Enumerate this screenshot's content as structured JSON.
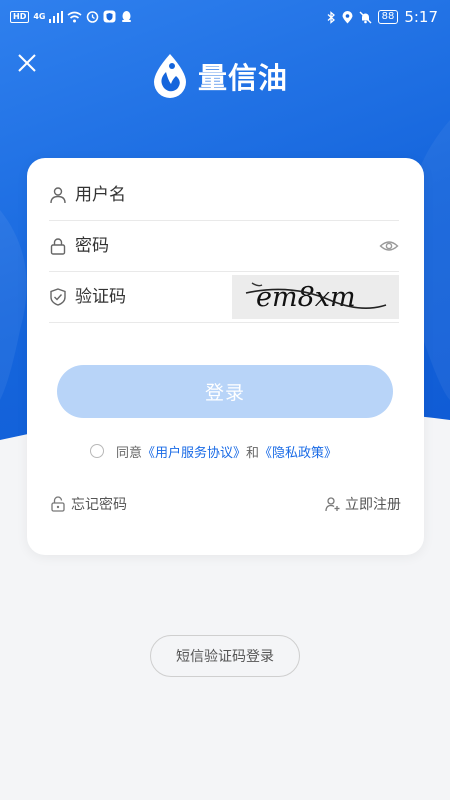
{
  "status_bar": {
    "hd": "HD",
    "network": "4G",
    "battery": "88",
    "time": "5:17"
  },
  "app": {
    "name": "量信油"
  },
  "form": {
    "username_placeholder": "用户名",
    "password_placeholder": "密码",
    "captcha_placeholder": "验证码",
    "captcha_text": "em8xm"
  },
  "login_button": "登录",
  "agreement": {
    "prefix": "同意",
    "terms": "《用户服务协议》",
    "and": "和",
    "privacy": "《隐私政策》"
  },
  "links": {
    "forgot": "忘记密码",
    "register": "立即注册"
  },
  "sms_login": "短信验证码登录",
  "colors": {
    "primary": "#1565dc",
    "button_disabled": "#b8d4f8",
    "link": "#1a6be6"
  }
}
